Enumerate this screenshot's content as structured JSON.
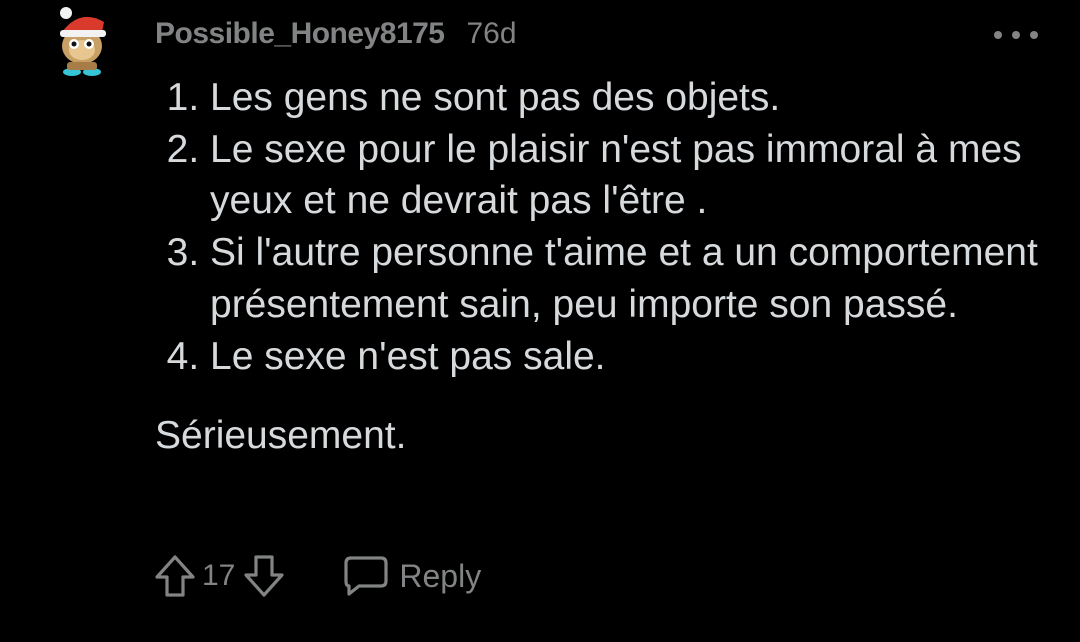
{
  "comment": {
    "username": "Possible_Honey8175",
    "age": "76d",
    "list_items": [
      "Les gens ne sont pas des objets.",
      "Le sexe pour le plaisir n'est pas immoral à mes yeux et ne devrait pas l'être .",
      "Si l'autre personne t'aime et a un comportement présentement sain, peu importe son passé.",
      "Le sexe n'est pas sale."
    ],
    "closing": "Sérieusement.",
    "score": "17",
    "reply_label": "Reply"
  },
  "icons": {
    "avatar": "snoo-avatar-santa-hat",
    "more": "more-options-icon",
    "upvote": "upvote-arrow-icon",
    "downvote": "downvote-arrow-icon",
    "reply": "speech-bubble-icon"
  },
  "colors": {
    "background": "#000000",
    "text": "#d7dadc",
    "meta": "#818384",
    "avatar_hat": "#d93a2b"
  }
}
